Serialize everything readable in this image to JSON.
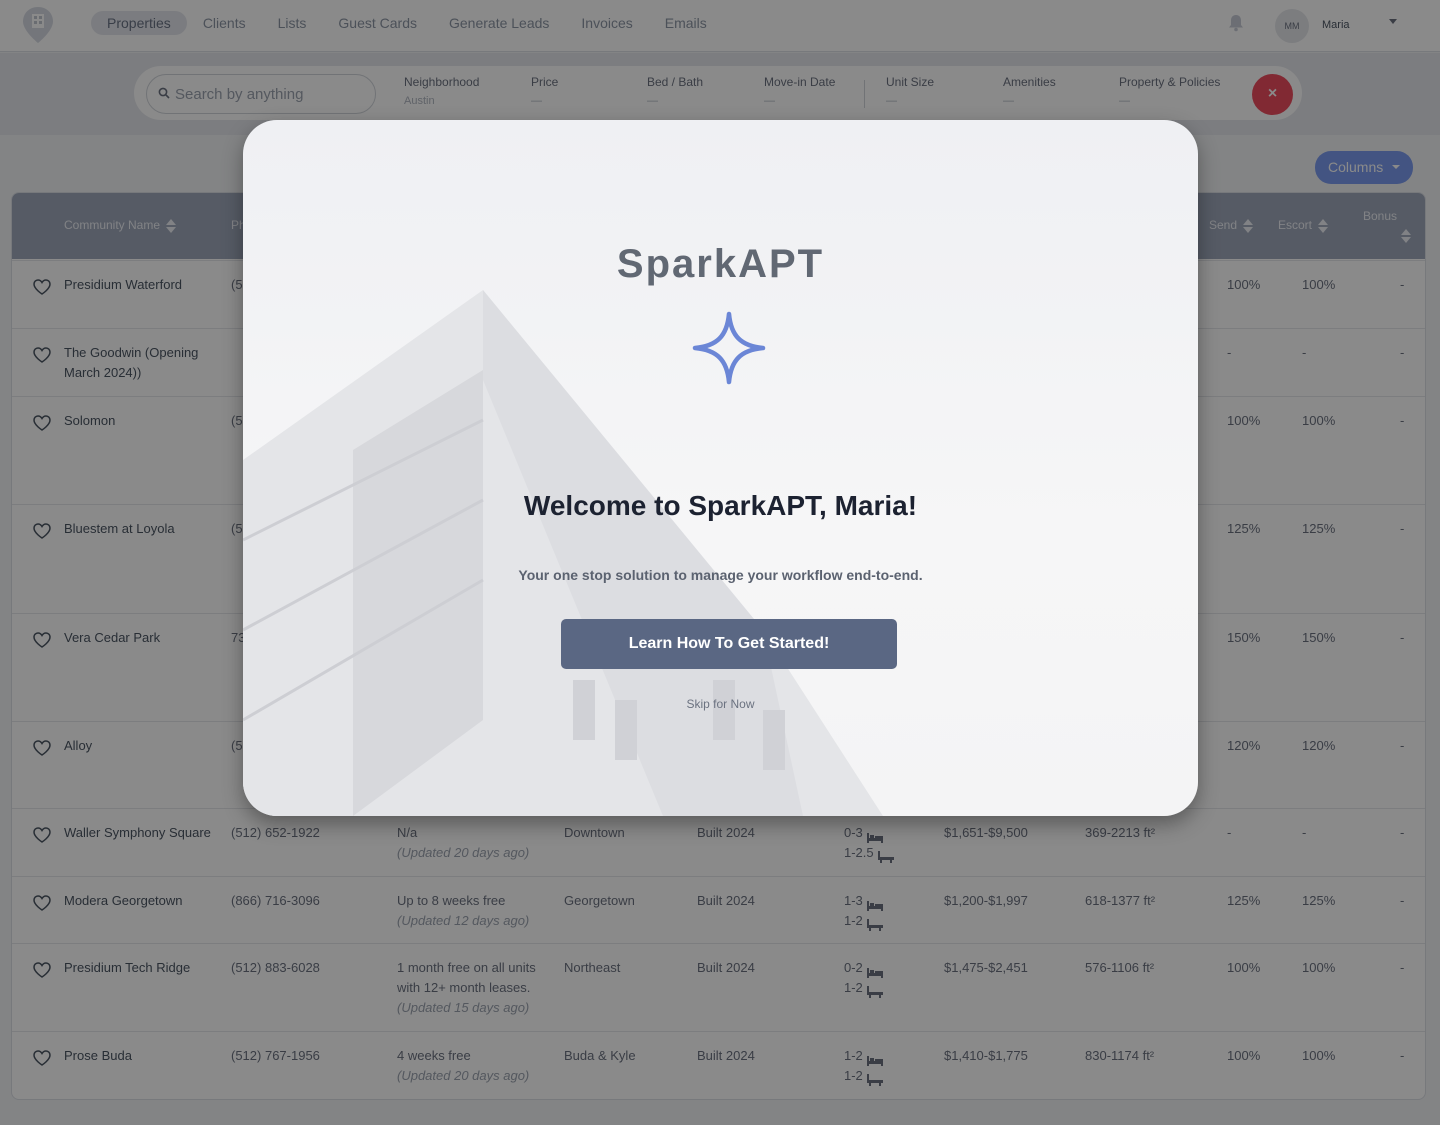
{
  "nav": {
    "links": [
      "Properties",
      "Clients",
      "Lists",
      "Guest Cards",
      "Generate Leads",
      "Invoices",
      "Emails"
    ],
    "user_initials": "MM",
    "user_name": "Maria"
  },
  "search": {
    "placeholder": "Search by anything"
  },
  "filters": [
    {
      "label": "Neighborhood",
      "value": "Austin"
    },
    {
      "label": "Price",
      "value": "—"
    },
    {
      "label": "Bed / Bath",
      "value": "—"
    },
    {
      "label": "Move-in Date",
      "value": "—"
    },
    {
      "label": "Unit Size",
      "value": "—"
    },
    {
      "label": "Amenities",
      "value": "—"
    },
    {
      "label": "Property & Policies",
      "value": "—"
    }
  ],
  "clear_label": "×",
  "columns_label": "Columns",
  "table": {
    "headers": {
      "community": "Community Name",
      "phone": "Ph",
      "send": "Send",
      "escort": "Escort",
      "bonus": "Bonus"
    },
    "rows": [
      {
        "name": "Presidium Waterford",
        "phone": "(5",
        "special": "",
        "updated": "",
        "hood": "",
        "built": "",
        "bed": "",
        "bath": "",
        "price": "",
        "size": "",
        "send": "100%",
        "escort": "100%",
        "bonus": "-"
      },
      {
        "name": "The Goodwin (Opening March 2024))",
        "phone": "",
        "special": "",
        "updated": "",
        "hood": "",
        "built": "",
        "bed": "",
        "bath": "",
        "price": "",
        "size": "",
        "send": "-",
        "escort": "-",
        "bonus": "-"
      },
      {
        "name": "Solomon",
        "phone": "(5",
        "special": "",
        "updated": "",
        "hood": "",
        "built": "",
        "bed": "",
        "bath": "",
        "price": "",
        "size": "",
        "send": "100%",
        "escort": "100%",
        "bonus": "-"
      },
      {
        "name": "Bluestem at Loyola",
        "phone": "(5",
        "special": "",
        "updated": "",
        "hood": "",
        "built": "",
        "bed": "",
        "bath": "",
        "price": "",
        "size": "",
        "send": "125%",
        "escort": "125%",
        "bonus": "-"
      },
      {
        "name": "Vera Cedar Park",
        "phone": "73",
        "special": "",
        "updated": "",
        "hood": "",
        "built": "",
        "bed": "",
        "bath": "",
        "price": "",
        "size": "",
        "send": "150%",
        "escort": "150%",
        "bonus": "-"
      },
      {
        "name": "Alloy",
        "phone": "(5",
        "special": "",
        "updated": "",
        "hood": "",
        "built": "",
        "bed": "",
        "bath": "",
        "price": "",
        "size": "",
        "send": "120%",
        "escort": "120%",
        "bonus": "-"
      },
      {
        "name": "Waller Symphony Square",
        "phone": "(512) 652-1922",
        "special": "N/a",
        "updated": "(Updated 20 days ago)",
        "hood": "Downtown",
        "built": "Built 2024",
        "bed": "0-3",
        "bath": "1-2.5",
        "price": "$1,651-$9,500",
        "size": "369-2213 ft²",
        "send": "-",
        "escort": "-",
        "bonus": "-"
      },
      {
        "name": "Modera Georgetown",
        "phone": "(866) 716-3096",
        "special": "Up to 8 weeks free",
        "updated": "(Updated 12 days ago)",
        "hood": "Georgetown",
        "built": "Built 2024",
        "bed": "1-3",
        "bath": "1-2",
        "price": "$1,200-$1,997",
        "size": "618-1377 ft²",
        "send": "125%",
        "escort": "125%",
        "bonus": "-"
      },
      {
        "name": "Presidium Tech Ridge",
        "phone": "(512) 883-6028",
        "special": "1 month free on all units with 12+ month leases.",
        "updated": "(Updated 15 days ago)",
        "hood": "Northeast",
        "built": "Built 2024",
        "bed": "0-2",
        "bath": "1-2",
        "price": "$1,475-$2,451",
        "size": "576-1106 ft²",
        "send": "100%",
        "escort": "100%",
        "bonus": "-"
      },
      {
        "name": "Prose Buda",
        "phone": "(512) 767-1956",
        "special": "4 weeks free",
        "updated": "(Updated 20 days ago)",
        "hood": "Buda & Kyle",
        "built": "Built 2024",
        "bed": "1-2",
        "bath": "1-2",
        "price": "$1,410-$1,775",
        "size": "830-1174 ft²",
        "send": "100%",
        "escort": "100%",
        "bonus": "-"
      }
    ]
  },
  "modal": {
    "brand": "SparkAPT",
    "welcome": "Welcome to SparkAPT, Maria!",
    "subtitle": "Your one stop solution to manage your workflow end-to-end.",
    "cta": "Learn How To Get Started!",
    "skip": "Skip for Now"
  },
  "colors": {
    "accent": "#7d9cf0",
    "cta": "#5a6783",
    "danger": "#ef4d5e",
    "header": "#9fa8bb"
  }
}
